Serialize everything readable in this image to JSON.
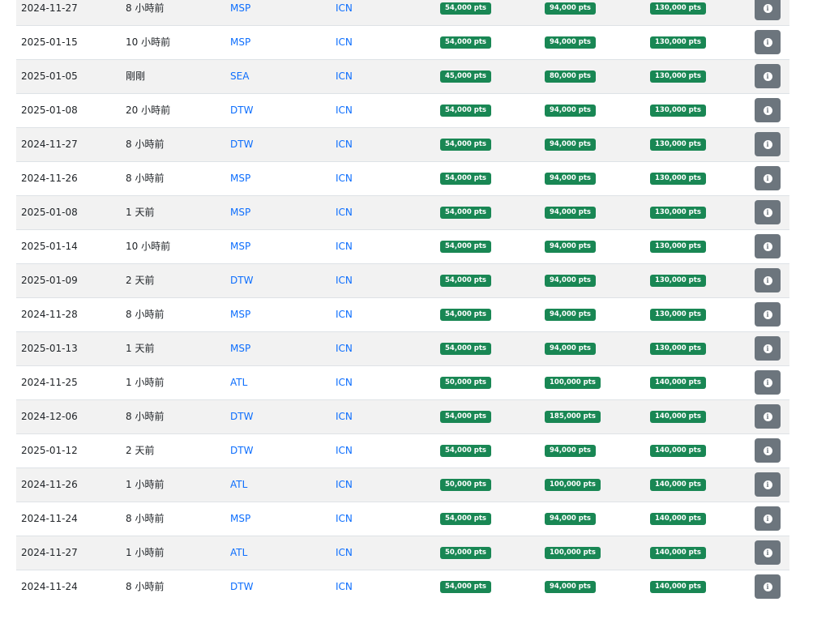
{
  "table": {
    "info_icon_glyph": "i",
    "colors": {
      "badge_green": "#198754",
      "link_blue": "#0d6efd",
      "button_gray": "#6c757d",
      "stripe": "#f2f2f2"
    },
    "rows": [
      {
        "date": "2024-11-27",
        "ago": "8 小時前",
        "from": "MSP",
        "to": "ICN",
        "b1": "54,000 pts",
        "b2": "94,000 pts",
        "b3": "130,000 pts"
      },
      {
        "date": "2025-01-15",
        "ago": "10 小時前",
        "from": "MSP",
        "to": "ICN",
        "b1": "54,000 pts",
        "b2": "94,000 pts",
        "b3": "130,000 pts"
      },
      {
        "date": "2025-01-05",
        "ago": "剛剛",
        "from": "SEA",
        "to": "ICN",
        "b1": "45,000 pts",
        "b2": "80,000 pts",
        "b3": "130,000 pts"
      },
      {
        "date": "2025-01-08",
        "ago": "20 小時前",
        "from": "DTW",
        "to": "ICN",
        "b1": "54,000 pts",
        "b2": "94,000 pts",
        "b3": "130,000 pts"
      },
      {
        "date": "2024-11-27",
        "ago": "8 小時前",
        "from": "DTW",
        "to": "ICN",
        "b1": "54,000 pts",
        "b2": "94,000 pts",
        "b3": "130,000 pts"
      },
      {
        "date": "2024-11-26",
        "ago": "8 小時前",
        "from": "MSP",
        "to": "ICN",
        "b1": "54,000 pts",
        "b2": "94,000 pts",
        "b3": "130,000 pts"
      },
      {
        "date": "2025-01-08",
        "ago": "1 天前",
        "from": "MSP",
        "to": "ICN",
        "b1": "54,000 pts",
        "b2": "94,000 pts",
        "b3": "130,000 pts"
      },
      {
        "date": "2025-01-14",
        "ago": "10 小時前",
        "from": "MSP",
        "to": "ICN",
        "b1": "54,000 pts",
        "b2": "94,000 pts",
        "b3": "130,000 pts"
      },
      {
        "date": "2025-01-09",
        "ago": "2 天前",
        "from": "DTW",
        "to": "ICN",
        "b1": "54,000 pts",
        "b2": "94,000 pts",
        "b3": "130,000 pts"
      },
      {
        "date": "2024-11-28",
        "ago": "8 小時前",
        "from": "MSP",
        "to": "ICN",
        "b1": "54,000 pts",
        "b2": "94,000 pts",
        "b3": "130,000 pts"
      },
      {
        "date": "2025-01-13",
        "ago": "1 天前",
        "from": "MSP",
        "to": "ICN",
        "b1": "54,000 pts",
        "b2": "94,000 pts",
        "b3": "130,000 pts"
      },
      {
        "date": "2024-11-25",
        "ago": "1 小時前",
        "from": "ATL",
        "to": "ICN",
        "b1": "50,000 pts",
        "b2": "100,000 pts",
        "b3": "140,000 pts"
      },
      {
        "date": "2024-12-06",
        "ago": "8 小時前",
        "from": "DTW",
        "to": "ICN",
        "b1": "54,000 pts",
        "b2": "185,000 pts",
        "b3": "140,000 pts"
      },
      {
        "date": "2025-01-12",
        "ago": "2 天前",
        "from": "DTW",
        "to": "ICN",
        "b1": "54,000 pts",
        "b2": "94,000 pts",
        "b3": "140,000 pts"
      },
      {
        "date": "2024-11-26",
        "ago": "1 小時前",
        "from": "ATL",
        "to": "ICN",
        "b1": "50,000 pts",
        "b2": "100,000 pts",
        "b3": "140,000 pts"
      },
      {
        "date": "2024-11-24",
        "ago": "8 小時前",
        "from": "MSP",
        "to": "ICN",
        "b1": "54,000 pts",
        "b2": "94,000 pts",
        "b3": "140,000 pts"
      },
      {
        "date": "2024-11-27",
        "ago": "1 小時前",
        "from": "ATL",
        "to": "ICN",
        "b1": "50,000 pts",
        "b2": "100,000 pts",
        "b3": "140,000 pts"
      },
      {
        "date": "2024-11-24",
        "ago": "8 小時前",
        "from": "DTW",
        "to": "ICN",
        "b1": "54,000 pts",
        "b2": "94,000 pts",
        "b3": "140,000 pts"
      }
    ]
  }
}
